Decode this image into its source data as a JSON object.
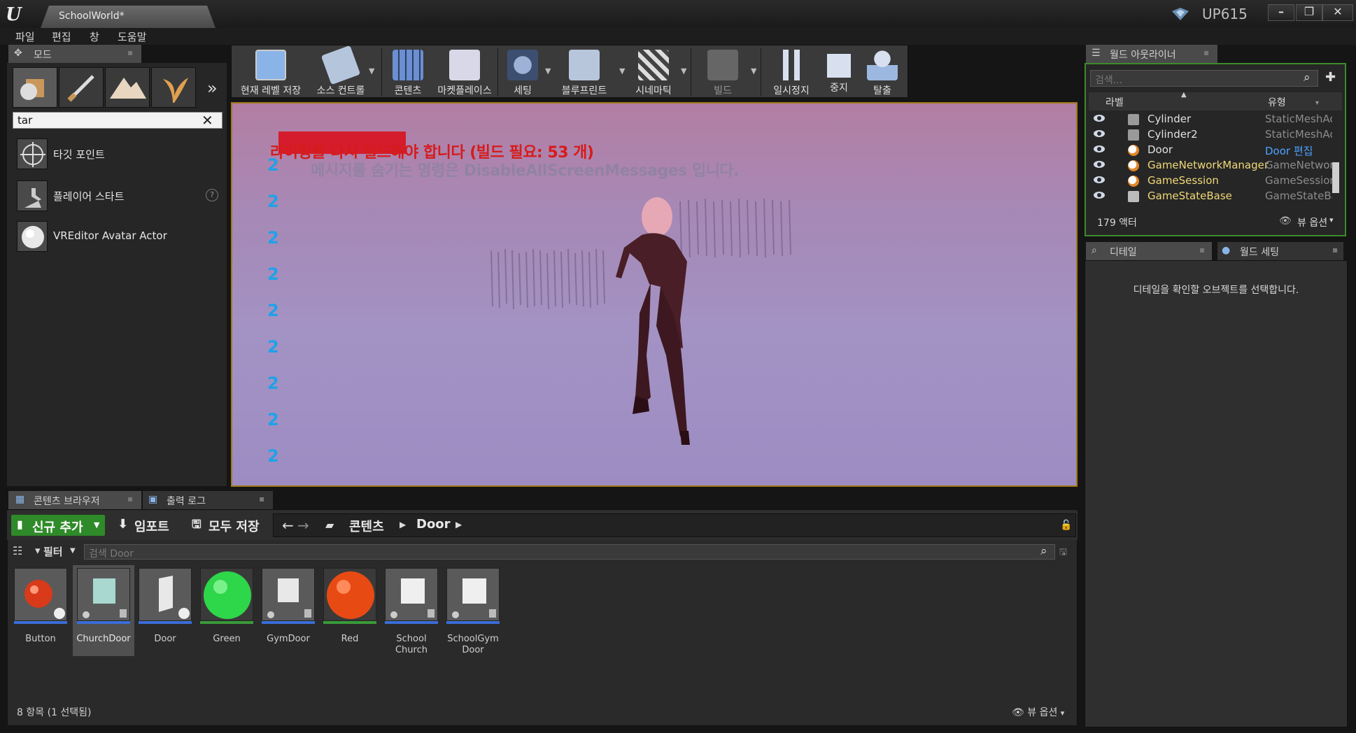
{
  "window": {
    "doc_tab": "SchoolWorld*",
    "project": "UP615",
    "min": "–",
    "max": "❐",
    "close": "✕"
  },
  "menu": [
    "파일",
    "편집",
    "창",
    "도움말"
  ],
  "modes": {
    "tab": "모드",
    "search_value": "tar",
    "results": [
      {
        "label": "타깃 포인트"
      },
      {
        "label": "플레이어 스타트"
      },
      {
        "label": "VREditor Avatar Actor"
      }
    ]
  },
  "toolbar": {
    "buttons": [
      {
        "label": "현재 레벨 저장"
      },
      {
        "label": "소스 컨트롤"
      },
      {
        "label": "콘텐츠"
      },
      {
        "label": "마켓플레이스"
      },
      {
        "label": "세팅"
      },
      {
        "label": "블루프린트"
      },
      {
        "label": "시네마틱"
      },
      {
        "label": "빌드"
      },
      {
        "label": "일시정지"
      },
      {
        "label": "중지"
      },
      {
        "label": "탈출"
      }
    ]
  },
  "viewport": {
    "message_error": "라이팅을 다시 빌드해야 합니다 (빌드 필요: 53 개)",
    "message_hint": "메시지를 숨기는 명령은 DisableAllScreenMessages 입니다.",
    "debug_numbers": [
      "2",
      "2",
      "2",
      "2",
      "2",
      "2",
      "2",
      "2",
      "2"
    ]
  },
  "outliner": {
    "tab": "월드 아웃라이너",
    "search_placeholder": "검색...",
    "col_label": "라벨",
    "col_type": "유형",
    "rows": [
      {
        "name": "Cylinder",
        "type": "StaticMeshAc"
      },
      {
        "name": "Cylinder2",
        "type": "StaticMeshAc"
      },
      {
        "name": "Door",
        "type": "Door 편집"
      },
      {
        "name": "GameNetworkManager",
        "type": "GameNetwork"
      },
      {
        "name": "GameSession",
        "type": "GameSession"
      },
      {
        "name": "GameStateBase",
        "type": "GameStateBa"
      }
    ],
    "actor_count": "179 액터",
    "view_options": "뷰 옵션"
  },
  "details": {
    "tab": "디테일",
    "tab2": "월드 세팅",
    "empty_text": "디테일을 확인할 오브젝트를 선택합니다."
  },
  "content_browser": {
    "tab": "콘텐츠 브라우저",
    "tab2": "출력 로그",
    "add_new": "신규 추가",
    "import": "임포트",
    "save_all": "모두 저장",
    "path_root": "콘텐츠",
    "path_current": "Door",
    "filter": "필터",
    "search_placeholder": "검색 Door",
    "assets": [
      {
        "label": "Button"
      },
      {
        "label": "ChurchDoor"
      },
      {
        "label": "Door"
      },
      {
        "label": "Green"
      },
      {
        "label": "GymDoor"
      },
      {
        "label": "Red"
      },
      {
        "label": "School Church"
      },
      {
        "label": "SchoolGym Door"
      }
    ],
    "status": "8 항목 (1 선택됨)",
    "view_options": "뷰 옵션"
  },
  "colors": {
    "accent_green": "#2f8a29",
    "viewport_border": "#a07a1a",
    "error_red": "#d61b1b",
    "debug_blue": "#1fa2e8"
  }
}
